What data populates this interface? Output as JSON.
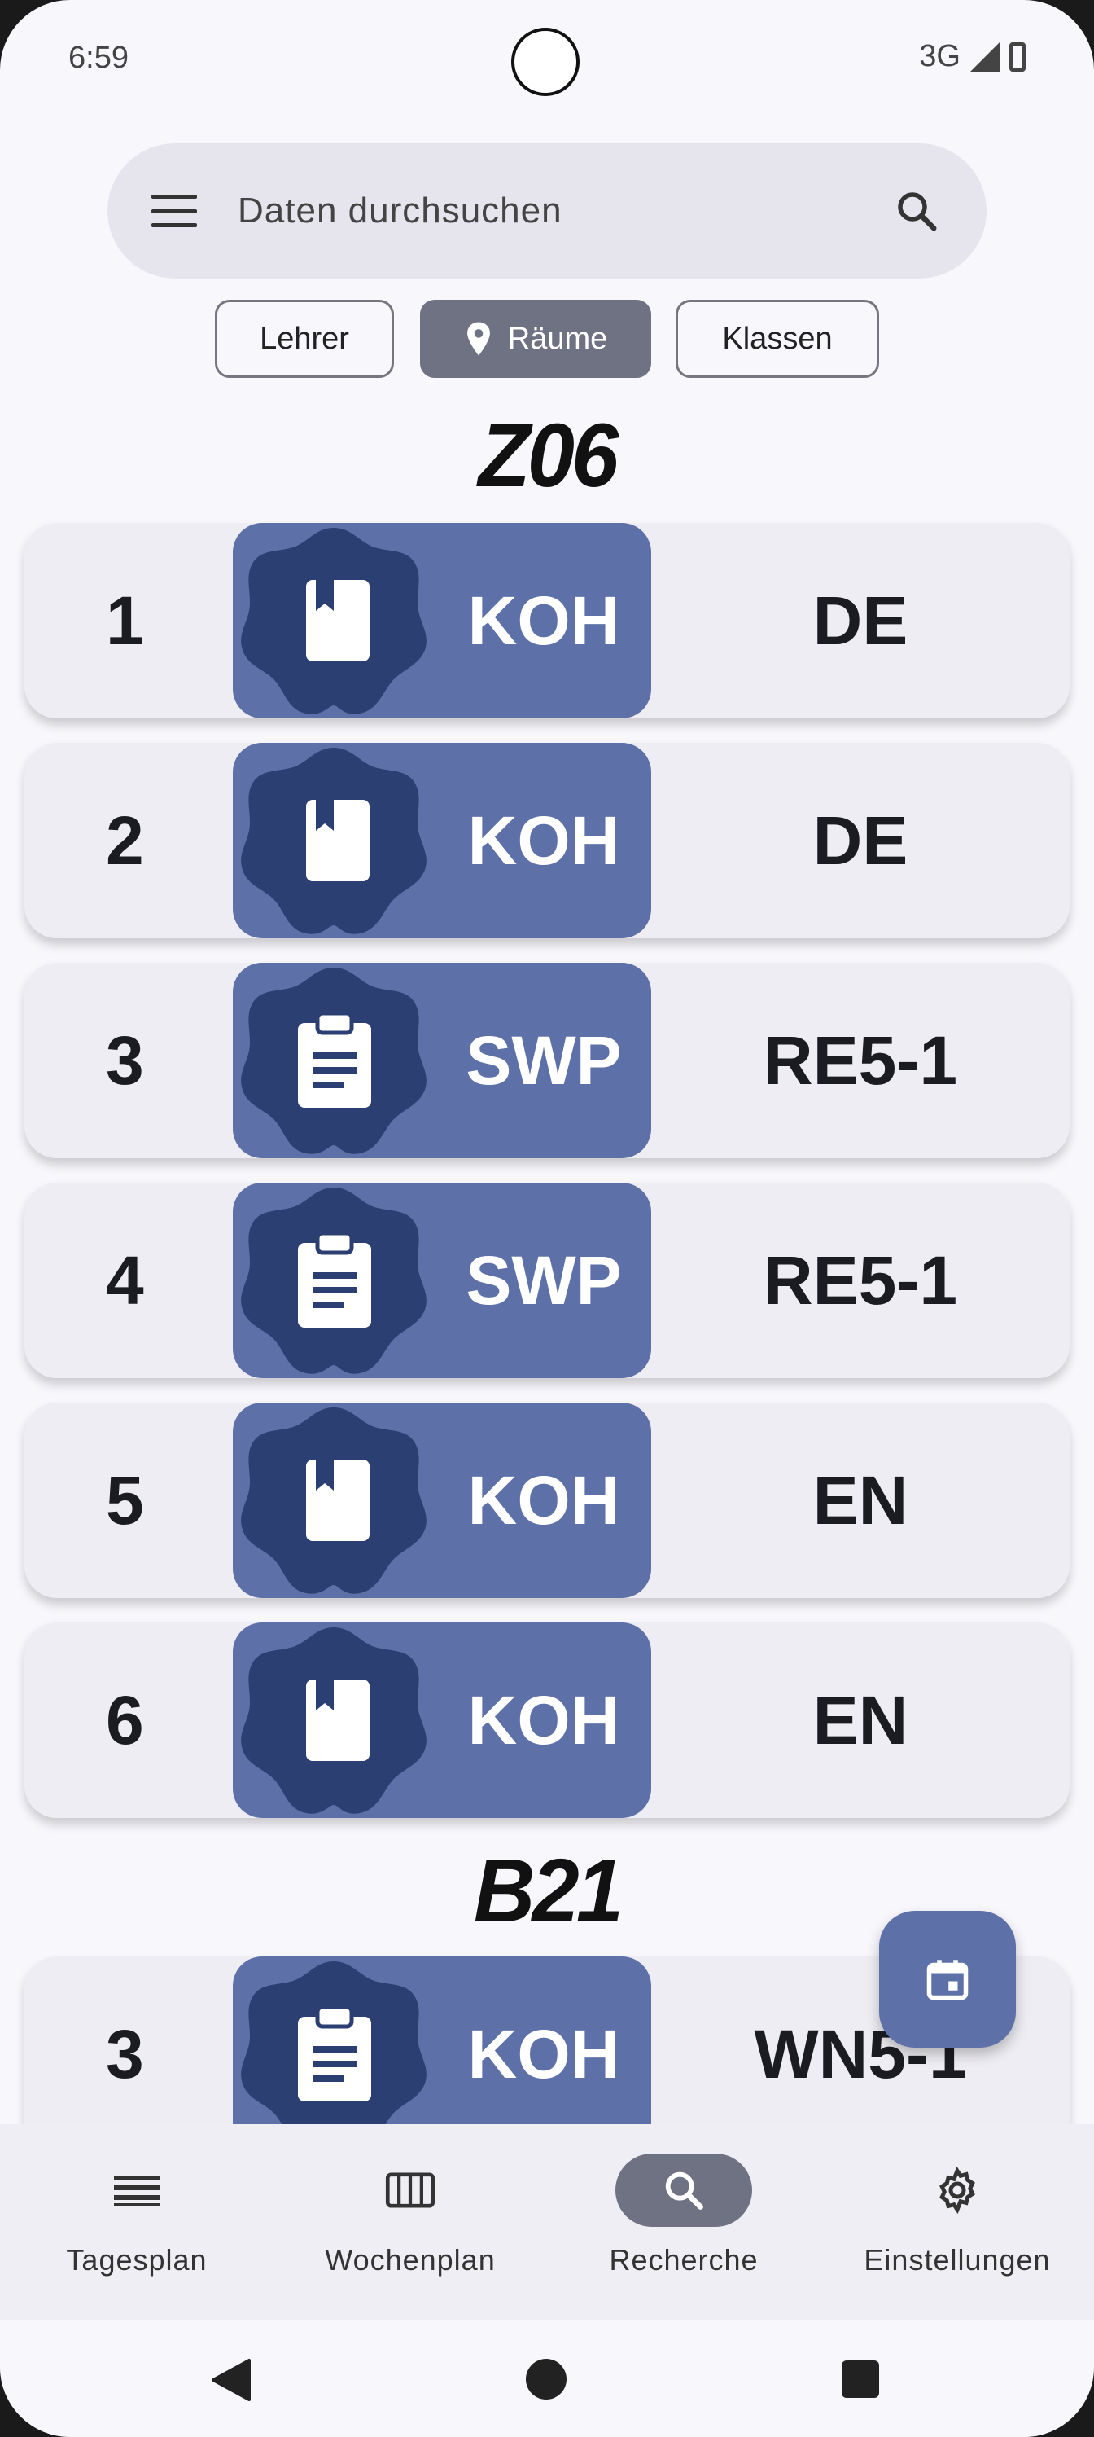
{
  "status_bar": {
    "time": "6:59",
    "network": "3G"
  },
  "search": {
    "placeholder": "Daten durchsuchen"
  },
  "filters": [
    {
      "label": "Lehrer",
      "selected": false
    },
    {
      "label": "Räume",
      "selected": true
    },
    {
      "label": "Klassen",
      "selected": false
    }
  ],
  "rooms": [
    {
      "name": "Z06",
      "lessons": [
        {
          "period": "1",
          "teacher": "KOH",
          "subject": "DE",
          "icon": "book-icon"
        },
        {
          "period": "2",
          "teacher": "KOH",
          "subject": "DE",
          "icon": "book-icon"
        },
        {
          "period": "3",
          "teacher": "SWP",
          "subject": "RE5-1",
          "icon": "clipboard-icon"
        },
        {
          "period": "4",
          "teacher": "SWP",
          "subject": "RE5-1",
          "icon": "clipboard-icon"
        },
        {
          "period": "5",
          "teacher": "KOH",
          "subject": "EN",
          "icon": "book-icon"
        },
        {
          "period": "6",
          "teacher": "KOH",
          "subject": "EN",
          "icon": "book-icon"
        }
      ]
    },
    {
      "name": "B21",
      "lessons": [
        {
          "period": "3",
          "teacher": "KOH",
          "subject": "WN5-1",
          "icon": "clipboard-icon"
        }
      ]
    }
  ],
  "bottom_nav": [
    {
      "label": "Tagesplan",
      "icon": "list-icon",
      "active": false
    },
    {
      "label": "Wochenplan",
      "icon": "week-grid-icon",
      "active": false
    },
    {
      "label": "Recherche",
      "icon": "search-icon",
      "active": true
    },
    {
      "label": "Einstellungen",
      "icon": "gear-icon",
      "active": false
    }
  ],
  "colors": {
    "accent": "#5d71a8",
    "accent_dark": "#2b3f72",
    "chip_selected": "#6e7283",
    "background": "#f8f7fc"
  }
}
